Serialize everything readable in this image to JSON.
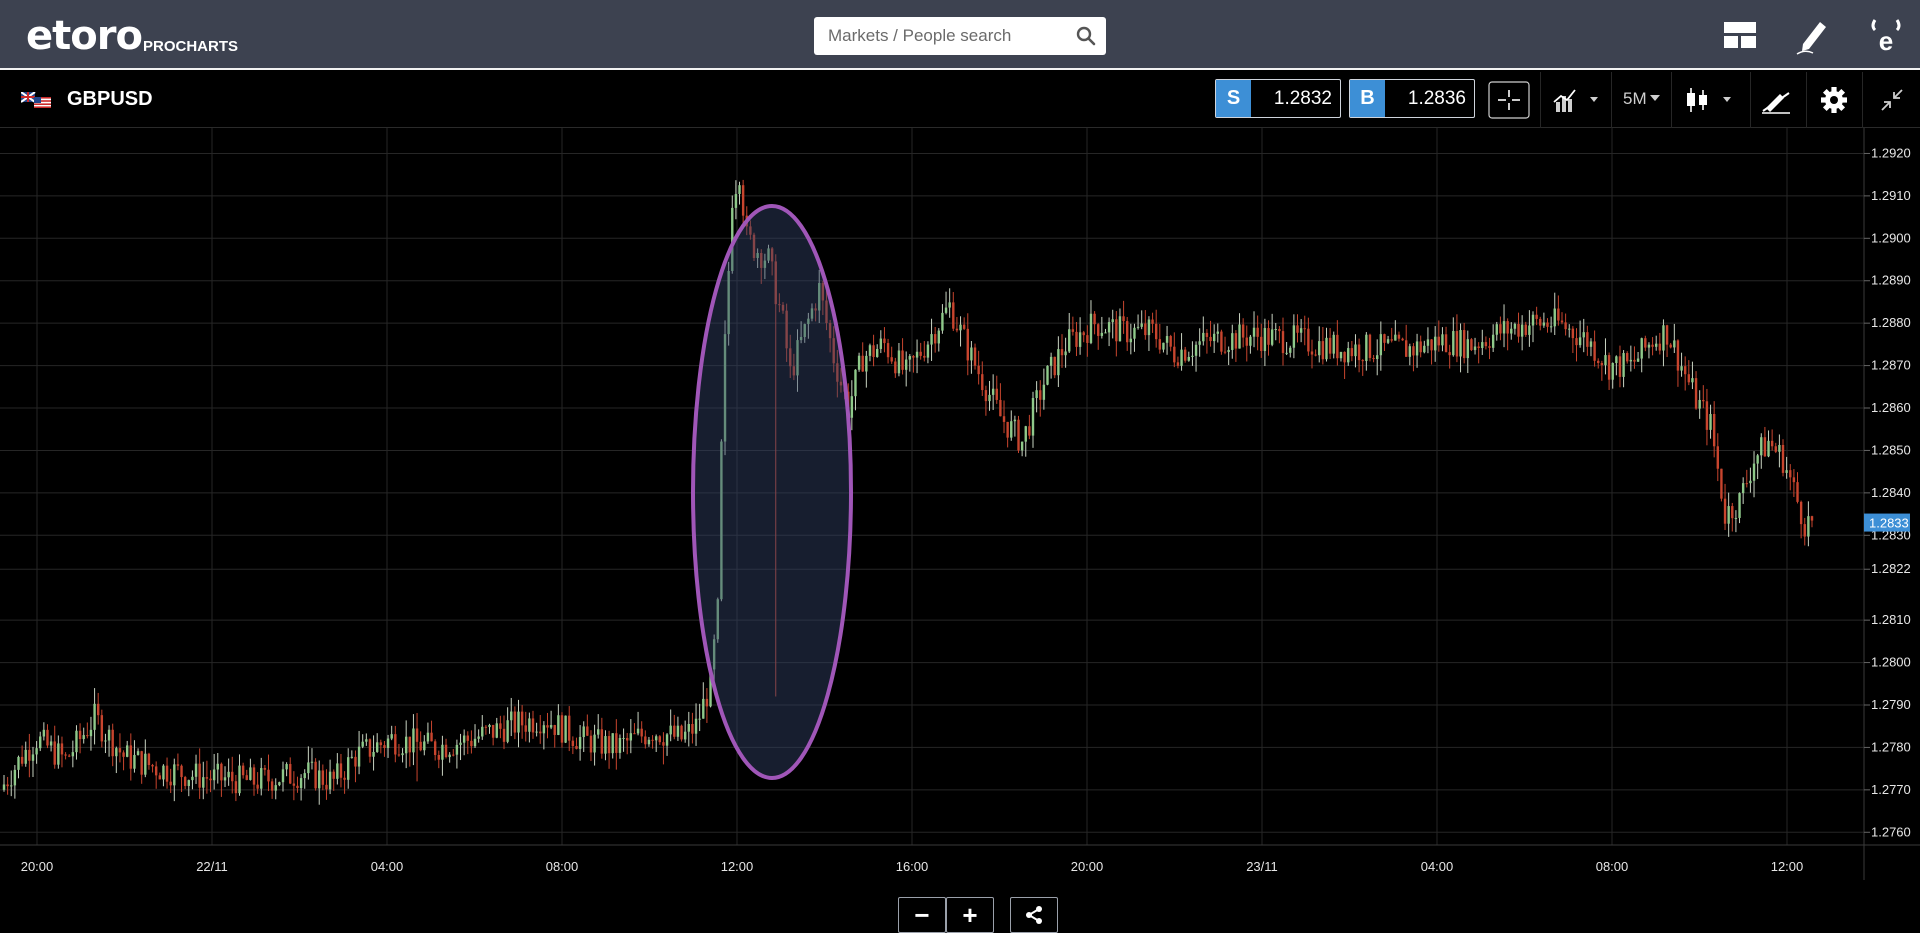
{
  "header": {
    "logo_text": "etoro",
    "logo_sub": "PROCHARTS",
    "search_placeholder": "Markets / People search",
    "icons": [
      "layout-icon",
      "edit-icon",
      "etoro-e-icon"
    ]
  },
  "instrument": {
    "symbol": "GBPUSD",
    "flag_icon": "gb-us-flag-icon",
    "sell_label": "S",
    "sell_price": "1.2832",
    "buy_label": "B",
    "buy_price": "1.2836",
    "timeframe": "5M",
    "tools": [
      "crosshair-icon",
      "indicators-icon",
      "timeframe-select",
      "candles-icon",
      "drawing-icon",
      "settings-icon",
      "collapse-icon"
    ]
  },
  "controls": {
    "zoom_out_label": "−",
    "zoom_in_label": "+",
    "share_icon": "share-icon"
  },
  "colors": {
    "up": "#8fc98a",
    "down": "#c8452e",
    "highlight": "#a056b8",
    "price_tag": "#3d8fd6"
  },
  "chart_data": {
    "type": "candlestick",
    "title": "",
    "current_price": "1.2833",
    "y_ticks": [
      "1.2920",
      "1.2910",
      "1.2900",
      "1.2890",
      "1.2880",
      "1.2870",
      "1.2860",
      "1.2850",
      "1.2840",
      "1.2830",
      "1.2822",
      "1.2810",
      "1.2800",
      "1.2790",
      "1.2780",
      "1.2770",
      "1.2760"
    ],
    "ylim": [
      1.2757,
      1.2926
    ],
    "x_ticks": [
      "20:00",
      "22/11",
      "04:00",
      "08:00",
      "12:00",
      "16:00",
      "20:00",
      "23/11",
      "04:00",
      "08:00",
      "12:00"
    ],
    "annotation": "highlighted ellipse around 12:00–14:30 spike",
    "anchors": [
      [
        0,
        1.277
      ],
      [
        6,
        1.2778
      ],
      [
        10,
        1.2782
      ],
      [
        18,
        1.2777
      ],
      [
        26,
        1.2787
      ],
      [
        34,
        1.2778
      ],
      [
        44,
        1.2775
      ],
      [
        56,
        1.2773
      ],
      [
        70,
        1.2772
      ],
      [
        84,
        1.2774
      ],
      [
        92,
        1.2772
      ],
      [
        98,
        1.2778
      ],
      [
        108,
        1.2782
      ],
      [
        120,
        1.278
      ],
      [
        130,
        1.2782
      ],
      [
        140,
        1.2785
      ],
      [
        150,
        1.2787
      ],
      [
        160,
        1.2782
      ],
      [
        170,
        1.278
      ],
      [
        180,
        1.2784
      ],
      [
        188,
        1.2782
      ],
      [
        192,
        1.2785
      ],
      [
        196,
        1.2795
      ],
      [
        198,
        1.2812
      ],
      [
        199,
        1.285
      ],
      [
        200,
        1.2875
      ],
      [
        202,
        1.291
      ],
      [
        204,
        1.2916
      ],
      [
        206,
        1.29
      ],
      [
        208,
        1.2898
      ],
      [
        212,
        1.2895
      ],
      [
        216,
        1.288
      ],
      [
        218,
        1.2868
      ],
      [
        222,
        1.2878
      ],
      [
        226,
        1.2888
      ],
      [
        230,
        1.2872
      ],
      [
        234,
        1.286
      ],
      [
        238,
        1.2872
      ],
      [
        244,
        1.2875
      ],
      [
        250,
        1.2868
      ],
      [
        256,
        1.2876
      ],
      [
        262,
        1.2884
      ],
      [
        268,
        1.2872
      ],
      [
        276,
        1.2858
      ],
      [
        282,
        1.2852
      ],
      [
        288,
        1.2866
      ],
      [
        294,
        1.2875
      ],
      [
        302,
        1.288
      ],
      [
        310,
        1.2878
      ],
      [
        318,
        1.2878
      ],
      [
        324,
        1.2873
      ],
      [
        334,
        1.2876
      ],
      [
        346,
        1.2877
      ],
      [
        358,
        1.2876
      ],
      [
        370,
        1.2874
      ],
      [
        378,
        1.2874
      ],
      [
        390,
        1.2874
      ],
      [
        398,
        1.2876
      ],
      [
        406,
        1.2875
      ],
      [
        414,
        1.2878
      ],
      [
        422,
        1.288
      ],
      [
        430,
        1.288
      ],
      [
        438,
        1.2876
      ],
      [
        444,
        1.287
      ],
      [
        450,
        1.287
      ],
      [
        456,
        1.2876
      ],
      [
        460,
        1.2878
      ],
      [
        464,
        1.287
      ],
      [
        468,
        1.2862
      ],
      [
        472,
        1.2856
      ],
      [
        476,
        1.2835
      ],
      [
        480,
        1.2838
      ],
      [
        484,
        1.2848
      ],
      [
        488,
        1.2852
      ],
      [
        492,
        1.2848
      ],
      [
        496,
        1.2838
      ],
      [
        498,
        1.2833
      ]
    ],
    "spikes": [
      [
        213,
        1.2792
      ],
      [
        114,
        1.2772
      ],
      [
        182,
        1.2776
      ]
    ]
  }
}
